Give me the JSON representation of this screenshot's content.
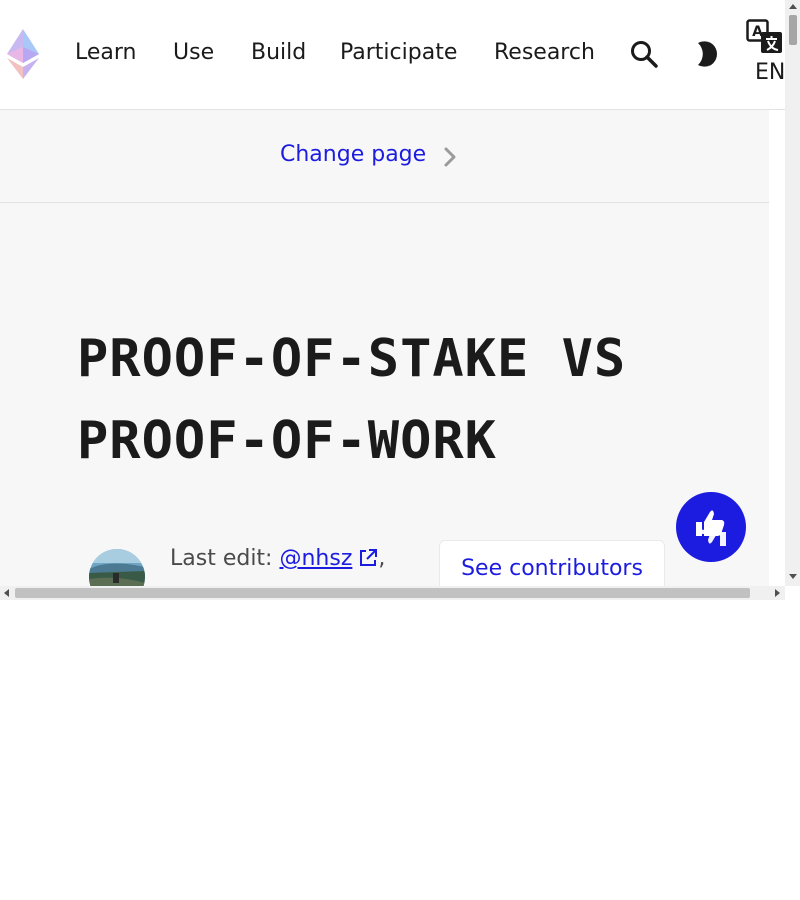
{
  "header": {
    "nav": [
      {
        "label": "Learn"
      },
      {
        "label": "Use"
      },
      {
        "label": "Build"
      },
      {
        "label": "Participate"
      },
      {
        "label": "Research"
      }
    ],
    "language": "EN",
    "icons": {
      "logo": "ethereum-logo-icon",
      "search": "search-icon",
      "theme": "dark-mode-icon",
      "translate": "translate-icon"
    }
  },
  "change_page": {
    "label": "Change page",
    "icon": "chevron-right-icon"
  },
  "page": {
    "title_line1": "PROOF-OF-STAKE VS",
    "title_line2": "PROOF-OF-WORK"
  },
  "last_edit": {
    "prefix": "Last edit: ",
    "author": "@nhsz",
    "suffix": ",",
    "contributors_button": "See contributors"
  },
  "colors": {
    "accent": "#1c1ce1",
    "text": "#1b1b1b",
    "background": "#f7f7f7"
  }
}
